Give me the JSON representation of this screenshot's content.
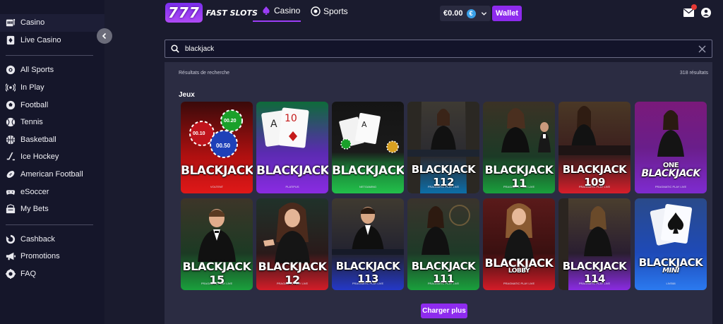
{
  "sidebar": {
    "items": [
      {
        "label": "Casino",
        "icon": "slot-machine-icon",
        "active": true
      },
      {
        "label": "Live Casino",
        "icon": "playing-card-icon"
      },
      {
        "label": "All Sports",
        "icon": "all-sports-icon"
      },
      {
        "label": "In Play",
        "icon": "broadcast-icon"
      },
      {
        "label": "Football",
        "icon": "soccer-ball-icon"
      },
      {
        "label": "Tennis",
        "icon": "tennis-ball-icon"
      },
      {
        "label": "Basketball",
        "icon": "basketball-icon"
      },
      {
        "label": "Ice Hockey",
        "icon": "hockey-stick-icon"
      },
      {
        "label": "American Football",
        "icon": "american-football-icon"
      },
      {
        "label": "eSoccer",
        "icon": "gamepad-icon"
      },
      {
        "label": "My Bets",
        "icon": "bets-icon"
      },
      {
        "label": "Cashback",
        "icon": "cashback-icon"
      },
      {
        "label": "Promotions",
        "icon": "megaphone-icon"
      },
      {
        "label": "FAQ",
        "icon": "faq-icon"
      }
    ]
  },
  "header": {
    "logo_777": "777",
    "logo_text": "FAST SLOTS",
    "tabs": [
      {
        "label": "Casino",
        "active": true
      },
      {
        "label": "Sports"
      }
    ],
    "balance": "€0.00",
    "currency_symbol": "€",
    "wallet_label": "Wallet"
  },
  "search": {
    "value": "blackjack"
  },
  "results": {
    "label": "Résultats de recherche",
    "count": "318 résultats",
    "section_title": "Jeux",
    "load_more": "Charger plus"
  },
  "games": [
    {
      "title": "BLACKJACK",
      "provider": "VOLTENT"
    },
    {
      "title": "BLACKJACK",
      "provider": "PLATIPUS"
    },
    {
      "title": "BLACKJACK",
      "provider": "NETGAMING"
    },
    {
      "title": "BLACKJACK 112",
      "provider": "PRAGMATIC PLAY LIVE"
    },
    {
      "title": "BLACKJACK 11",
      "provider": "PRAGMATIC PLAY LIVE"
    },
    {
      "title": "BLACKJACK 109",
      "provider": "PRAGMATIC PLAY LIVE"
    },
    {
      "title_line1": "ONE",
      "title_line2": "BLACKJACK",
      "provider": "PRAGMATIC PLAY LIVE"
    },
    {
      "title": "BLACKJACK 15",
      "provider": "PRAGMATIC PLAY LIVE"
    },
    {
      "title": "BLACKJACK 12",
      "provider": "PRAGMATIC PLAY LIVE"
    },
    {
      "title": "BLACKJACK 113",
      "provider": "PRAGMATIC PLAY LIVE"
    },
    {
      "title": "BLACKJACK 111",
      "provider": "PRAGMATIC PLAY LIVE"
    },
    {
      "title_line1": "BLACKJACK",
      "title_line2": "LOBBY",
      "provider": "PRAGMATIC PLAY LIVE"
    },
    {
      "title": "BLACKJACK 114",
      "provider": "PRAGMATIC PLAY LIVE"
    },
    {
      "title_line1": "BLACKJACK",
      "title_line2": "MINI",
      "provider": "LIVE88"
    }
  ],
  "chips": [
    "00.10",
    "00.20",
    "00.50"
  ],
  "colors": {
    "accent": "#8e2bee",
    "sidebar_bg": "#15162a",
    "page_bg": "#1a1b2e",
    "panel_bg": "#2b2c42"
  }
}
